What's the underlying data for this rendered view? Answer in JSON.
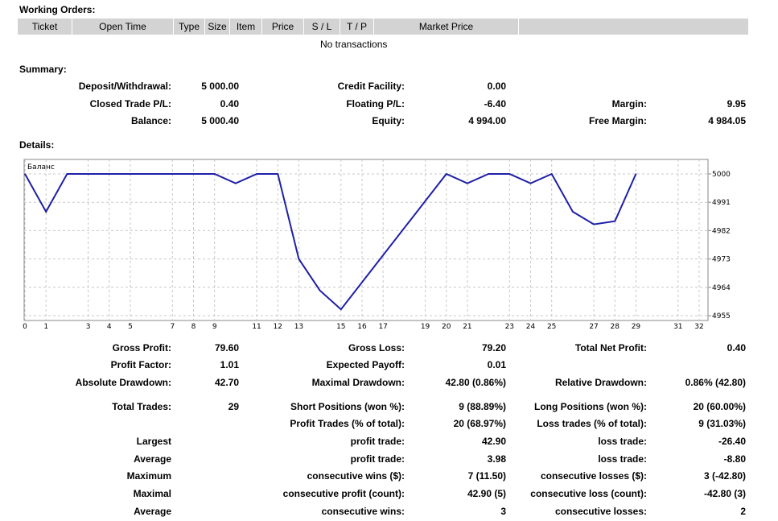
{
  "working_orders": {
    "title": "Working Orders:",
    "columns": [
      "Ticket",
      "Open Time",
      "Type",
      "Size",
      "Item",
      "Price",
      "S / L",
      "T / P",
      "Market Price",
      ""
    ],
    "empty_text": "No transactions"
  },
  "summary": {
    "title": "Summary:",
    "deposit_label": "Deposit/Withdrawal:",
    "deposit_value": "5 000.00",
    "credit_label": "Credit Facility:",
    "credit_value": "0.00",
    "closed_pl_label": "Closed Trade P/L:",
    "closed_pl_value": "0.40",
    "floating_pl_label": "Floating P/L:",
    "floating_pl_value": "-6.40",
    "margin_label": "Margin:",
    "margin_value": "9.95",
    "balance_label": "Balance:",
    "balance_value": "5 000.40",
    "equity_label": "Equity:",
    "equity_value": "4 994.00",
    "free_margin_label": "Free Margin:",
    "free_margin_value": "4 984.05"
  },
  "details": {
    "title": "Details:"
  },
  "chart_data": {
    "type": "line",
    "title": "Баланс",
    "x": [
      0,
      1,
      2,
      9,
      10,
      11,
      12,
      13,
      14,
      15,
      20,
      21,
      22,
      23,
      24,
      25,
      26,
      27,
      28,
      29
    ],
    "series": [
      {
        "name": "Баланс",
        "color": "#1f1fa8",
        "values": [
          5000,
          4988,
          5000,
          5000,
          4997,
          5000,
          5000,
          4973,
          4963,
          4957,
          5000,
          4997,
          5000,
          5000,
          4997,
          5000,
          4988,
          4984,
          4985,
          5000
        ]
      }
    ],
    "x_ticks": [
      0,
      1,
      3,
      4,
      5,
      7,
      8,
      9,
      11,
      12,
      13,
      15,
      16,
      17,
      19,
      20,
      21,
      23,
      24,
      25,
      27,
      28,
      29,
      31,
      32
    ],
    "y_ticks": [
      5000,
      4991,
      4982,
      4973,
      4964,
      4955
    ],
    "xlim": [
      0,
      32
    ],
    "ylim": [
      4955,
      5000
    ],
    "grid": true
  },
  "stats": {
    "gross_profit_label": "Gross Profit:",
    "gross_profit_value": "79.60",
    "gross_loss_label": "Gross Loss:",
    "gross_loss_value": "79.20",
    "total_net_label": "Total Net Profit:",
    "total_net_value": "0.40",
    "profit_factor_label": "Profit Factor:",
    "profit_factor_value": "1.01",
    "expected_payoff_label": "Expected Payoff:",
    "expected_payoff_value": "0.01",
    "abs_dd_label": "Absolute Drawdown:",
    "abs_dd_value": "42.70",
    "max_dd_label": "Maximal Drawdown:",
    "max_dd_value": "42.80 (0.86%)",
    "rel_dd_label": "Relative Drawdown:",
    "rel_dd_value": "0.86% (42.80)",
    "total_trades_label": "Total Trades:",
    "total_trades_value": "29",
    "short_label": "Short Positions (won %):",
    "short_value": "9 (88.89%)",
    "long_label": "Long Positions (won %):",
    "long_value": "20 (60.00%)",
    "profit_trades_label": "Profit Trades (% of total):",
    "profit_trades_value": "20 (68.97%)",
    "loss_trades_label": "Loss trades (% of total):",
    "loss_trades_value": "9 (31.03%)",
    "largest_label": "Largest",
    "largest_profit_label": "profit trade:",
    "largest_profit_value": "42.90",
    "largest_loss_label": "loss trade:",
    "largest_loss_value": "-26.40",
    "average_label": "Average",
    "average_profit_label": "profit trade:",
    "average_profit_value": "3.98",
    "average_loss_label": "loss trade:",
    "average_loss_value": "-8.80",
    "maximum_label": "Maximum",
    "max_cons_wins_label": "consecutive wins ($):",
    "max_cons_wins_value": "7 (11.50)",
    "max_cons_losses_label": "consecutive losses ($):",
    "max_cons_losses_value": "3 (-42.80)",
    "maximal_label": "Maximal",
    "maximal_profit_label": "consecutive profit (count):",
    "maximal_profit_value": "42.90 (5)",
    "maximal_loss_label": "consecutive loss (count):",
    "maximal_loss_value": "-42.80 (3)",
    "average2_label": "Average",
    "avg_cons_wins_label": "consecutive wins:",
    "avg_cons_wins_value": "3",
    "avg_cons_losses_label": "consecutive losses:",
    "avg_cons_losses_value": "2"
  }
}
